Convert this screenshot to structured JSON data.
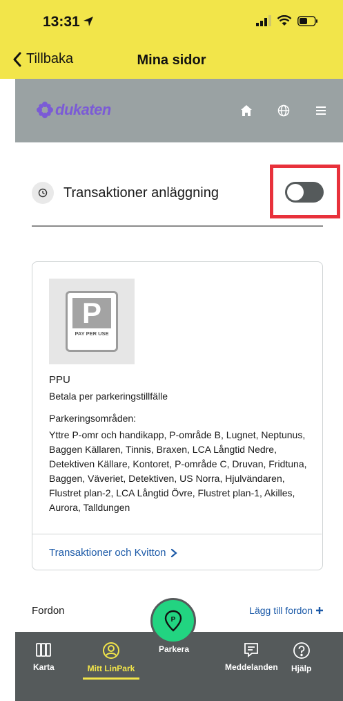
{
  "status": {
    "time": "13:31"
  },
  "nav": {
    "back_label": "Tillbaka",
    "title": "Mina sidor"
  },
  "site": {
    "logo_text": "dukaten",
    "logo_color": "#7b5bd6"
  },
  "toggle_section": {
    "label": "Transaktioner anläggning",
    "enabled": false
  },
  "card": {
    "image_letter": "P",
    "image_caption": "PAY PER USE",
    "title": "PPU",
    "subtitle": "Betala per parkeringstillfälle",
    "areas_label": "Parkeringsområden:",
    "areas_text": "Yttre P-omr och handikapp, P-område B, Lugnet, Neptunus, Baggen Källaren, Tinnis, Braxen, LCA Långtid Nedre, Detektiven Källare, Kontoret, P-område C, Druvan, Fridtuna, Baggen, Väveriet, Detektiven, US Norra, Hjulvändaren, Flustret plan-2, LCA Långtid Övre, Flustret plan-1, Akilles, Aurora, Talldungen",
    "link_label": "Transaktioner och Kvitton"
  },
  "vehicles": {
    "label": "Fordon",
    "add_label": "Lägg till fordon"
  },
  "tabbar": {
    "tabs": [
      {
        "label": "Karta",
        "icon": "map-icon"
      },
      {
        "label": "Mitt LinPark",
        "icon": "user-icon"
      },
      {
        "label": "Parkera",
        "icon": "parking-pin-icon"
      },
      {
        "label": "Meddelanden",
        "icon": "message-icon"
      },
      {
        "label": "Hjälp",
        "icon": "help-icon"
      }
    ],
    "active_index": 1
  },
  "colors": {
    "yellow": "#f2e54a",
    "gray_header": "#9aa2a3",
    "dark_bar": "#555a5b",
    "green": "#22d481",
    "link_blue": "#1c5aa8",
    "highlight_red": "#e8313b"
  }
}
